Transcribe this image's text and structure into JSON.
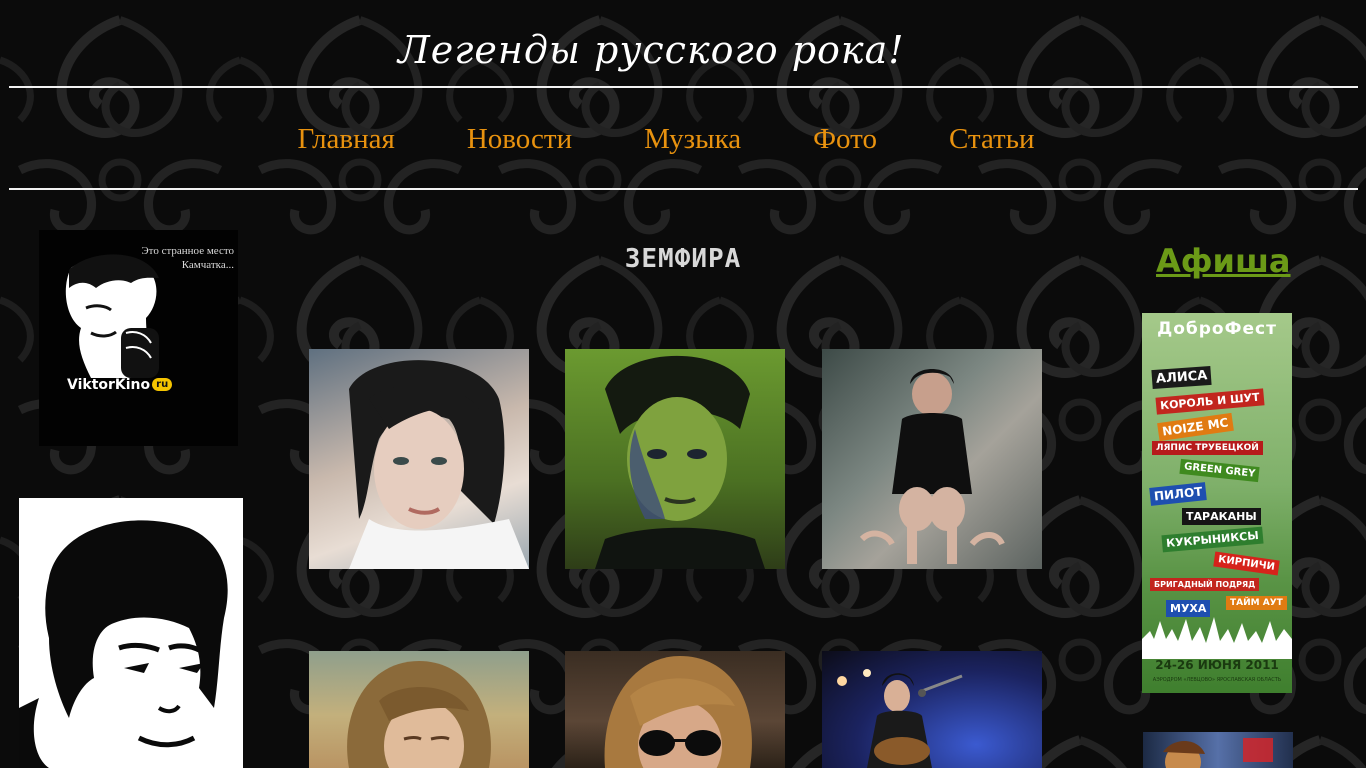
{
  "site": {
    "title": "Легенды русского рока!"
  },
  "nav": {
    "items": [
      {
        "label": "Главная"
      },
      {
        "label": "Новости"
      },
      {
        "label": "Музыка"
      },
      {
        "label": "Фото"
      },
      {
        "label": "Статьи"
      }
    ],
    "link_color": "#e8920f"
  },
  "left_banners": {
    "viktorkino": {
      "quote_line1": "Это странное место",
      "quote_line2": "Камчатка...",
      "brand": "ViktorKino",
      "brand_suffix": "ru"
    }
  },
  "main": {
    "section_title": "ЗЕМФИРА"
  },
  "sidebar_right": {
    "afisha_label": "Афиша",
    "afisha_color": "#6b9a17",
    "poster": {
      "title": "ДоброФест",
      "bands": [
        "АЛИСА",
        "КОРОЛЬ И ШУТ",
        "NOIZE MC",
        "ЛЯПИС ТРУБЕЦКОЙ",
        "GREEN GREY",
        "ПИЛОТ",
        "ТАРАКАНЫ",
        "КУКРЫНИКСЫ",
        "КИРПИЧИ",
        "БРИГАДНЫЙ ПОДРЯД",
        "МУХА",
        "ТАЙМ АУТ"
      ],
      "dates": "24-26 ИЮНЯ 2011",
      "venue": "АЭРОДРОМ «ЛЕВЦОВО» ЯРОСЛАВСКАЯ ОБЛАСТЬ"
    }
  }
}
